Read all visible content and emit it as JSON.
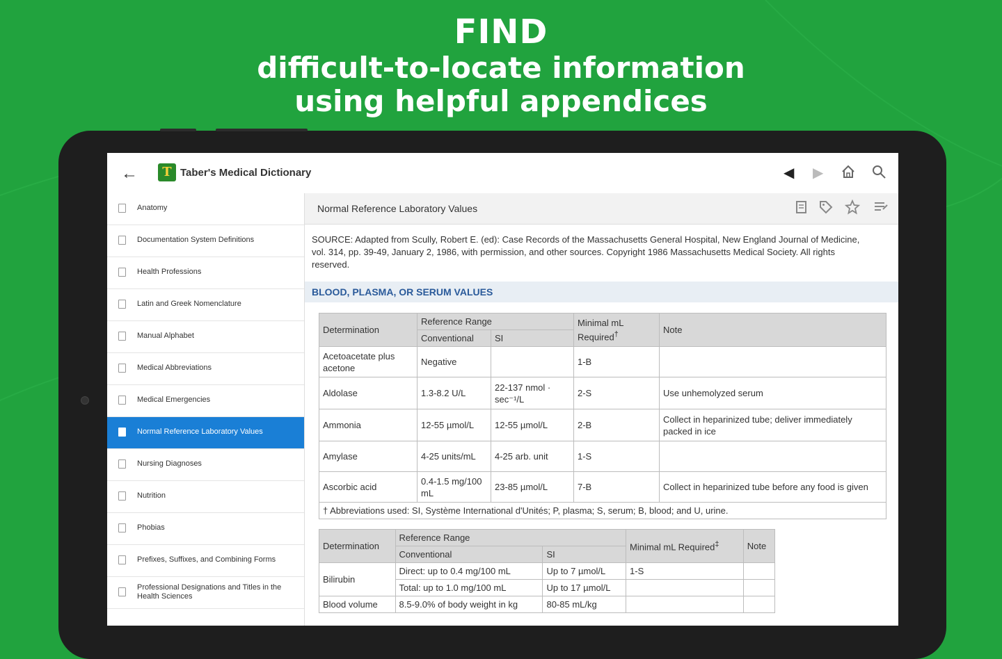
{
  "headline": {
    "line1": "FIND",
    "line2": "difficult-to-locate information",
    "line3": "using helpful appendices"
  },
  "appbar": {
    "back_icon": "arrow-left-icon",
    "logo_letter": "T",
    "title": "Taber's Medical Dictionary",
    "icons": [
      "caret-left-icon",
      "caret-right-icon",
      "home-icon",
      "search-icon"
    ]
  },
  "sidebar": {
    "items": [
      {
        "label": "Anatomy"
      },
      {
        "label": "Documentation System Definitions"
      },
      {
        "label": "Health Professions"
      },
      {
        "label": "Latin and Greek Nomenclature"
      },
      {
        "label": "Manual Alphabet"
      },
      {
        "label": "Medical Abbreviations"
      },
      {
        "label": "Medical Emergencies"
      },
      {
        "label": "Normal Reference Laboratory Values"
      },
      {
        "label": "Nursing Diagnoses"
      },
      {
        "label": "Nutrition"
      },
      {
        "label": "Phobias"
      },
      {
        "label": "Prefixes, Suffixes, and Combining Forms"
      },
      {
        "label": "Professional Designations and Titles in the Health Sciences"
      }
    ],
    "active_index": 7
  },
  "content": {
    "title": "Normal Reference Laboratory Values",
    "toolbar_icons": [
      "notes-icon",
      "tag-icon",
      "star-icon",
      "list-icon"
    ],
    "source": "SOURCE: Adapted from Scully, Robert E. (ed): Case Records of the Massachusetts General Hospital, New England Journal of Medicine, vol. 314, pp. 39-49, January 2, 1986, with permission, and other sources. Copyright 1986 Massachusetts Medical Society. All rights reserved.",
    "section_title": "BLOOD, PLASMA, OR SERUM VALUES",
    "table1": {
      "headers": {
        "determination": "Determination",
        "reference_range": "Reference Range",
        "conventional": "Conventional",
        "si": "SI",
        "minimal": "Minimal mL Required",
        "minimal_sup": "†",
        "note": "Note"
      },
      "rows": [
        {
          "det": "Acetoacetate plus acetone",
          "conv": "Negative",
          "si": "",
          "min": "1-B",
          "note": ""
        },
        {
          "det": "Aldolase",
          "conv": "1.3-8.2 U/L",
          "si": "22-137 nmol · sec⁻¹/L",
          "min": "2-S",
          "note": "Use unhemolyzed serum"
        },
        {
          "det": "Ammonia",
          "conv": "12-55 µmol/L",
          "si": "12-55 µmol/L",
          "min": "2-B",
          "note": "Collect in heparinized tube; deliver immediately packed in ice"
        },
        {
          "det": "Amylase",
          "conv": "4-25 units/mL",
          "si": "4-25 arb. unit",
          "min": "1-S",
          "note": ""
        },
        {
          "det": "Ascorbic acid",
          "conv": "0.4-1.5 mg/100 mL",
          "si": "23-85 µmol/L",
          "min": "7-B",
          "note": "Collect in heparinized tube before any food is given"
        }
      ],
      "footnote": "† Abbreviations used: SI, Système International d'Unités; P, plasma; S, serum; B, blood; and U, urine."
    },
    "table2": {
      "headers": {
        "determination": "Determination",
        "reference_range": "Reference Range",
        "conventional": "Conventional",
        "si": "SI",
        "minimal": "Minimal mL Required",
        "minimal_sup": "‡",
        "note": "Note"
      },
      "bilirubin": {
        "det": "Bilirubin",
        "direct_conv": "Direct: up to 0.4 mg/100 mL",
        "direct_si": "Up to 7 µmol/L",
        "direct_min": "1-S",
        "total_conv": "Total: up to 1.0 mg/100 mL",
        "total_si": "Up to 17 µmol/L"
      },
      "blood_volume": {
        "det": "Blood volume",
        "conv": "8.5-9.0% of body weight in kg",
        "si": "80-85 mL/kg"
      }
    }
  }
}
